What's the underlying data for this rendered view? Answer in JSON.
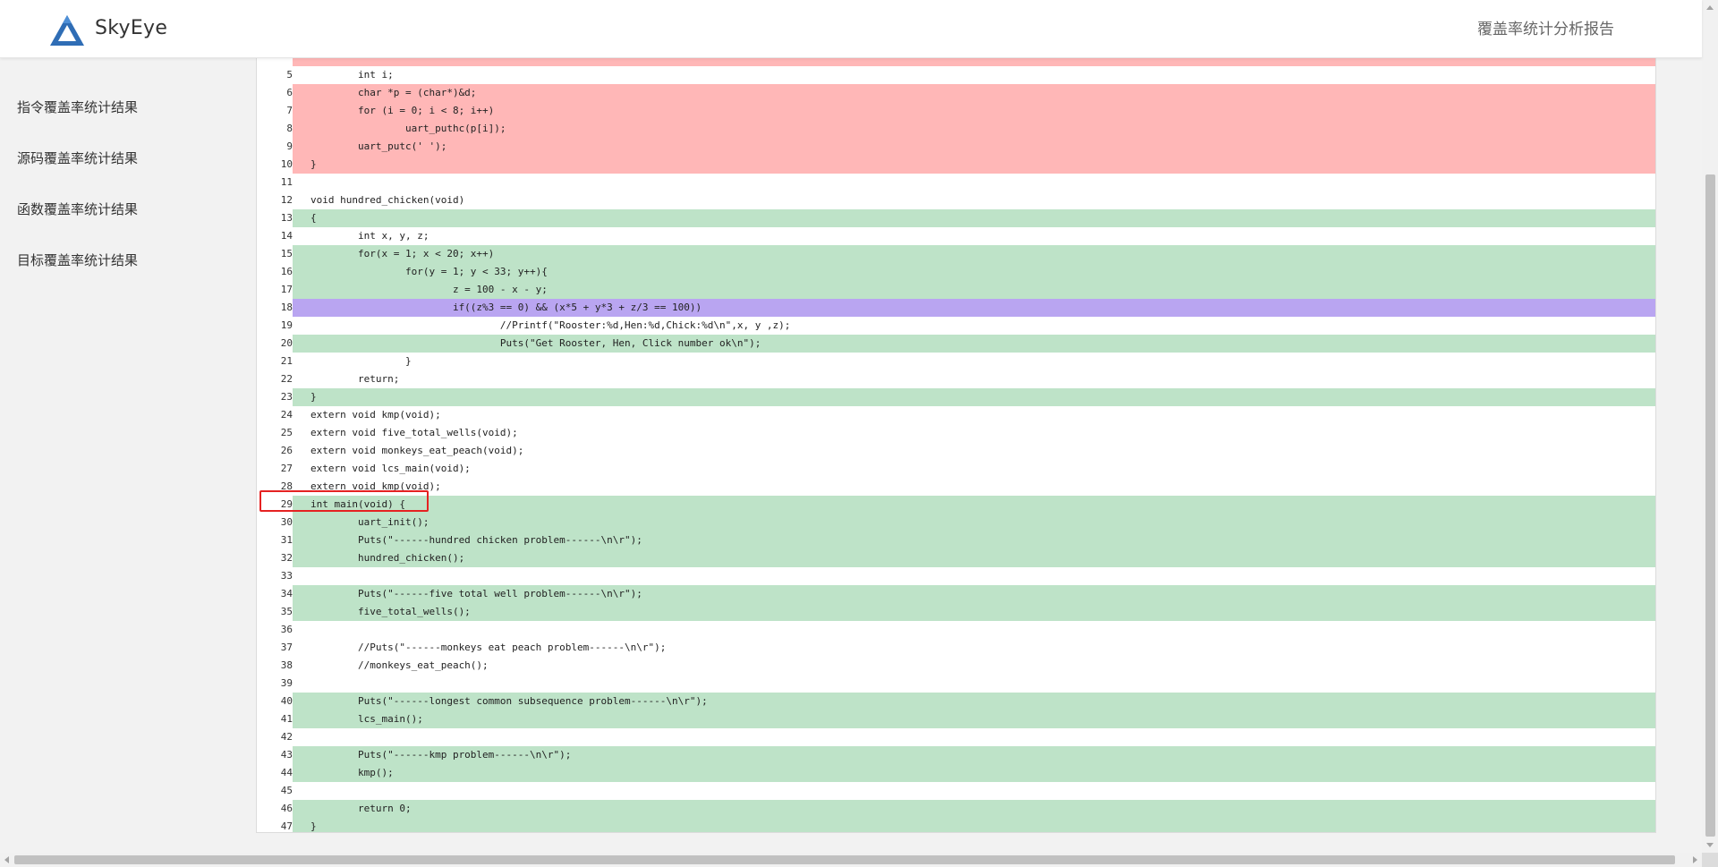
{
  "header": {
    "brand": "SkyEye",
    "report_title": "覆盖率统计分析报告",
    "logo_icon": "skyeye-logo-icon",
    "logo_color": "#2f6db5"
  },
  "sidebar": {
    "items": [
      {
        "label": "指令覆盖率统计结果"
      },
      {
        "label": "源码覆盖率统计结果"
      },
      {
        "label": "函数覆盖率统计结果"
      },
      {
        "label": "目标覆盖率统计结果"
      }
    ]
  },
  "colors": {
    "uncovered": "#ffb7b7",
    "covered": "#bee3c8",
    "partial": "#b9a5f1",
    "highlight_box": "#e52222"
  },
  "code": {
    "highlighted_line": "29",
    "lines": [
      {
        "num": "",
        "text": "    ",
        "cov": "red"
      },
      {
        "num": "5",
        "text": "        int i;",
        "cov": "none"
      },
      {
        "num": "6",
        "text": "        char *p = (char*)&d;",
        "cov": "red"
      },
      {
        "num": "7",
        "text": "        for (i = 0; i < 8; i++)",
        "cov": "red"
      },
      {
        "num": "8",
        "text": "                uart_puthc(p[i]);",
        "cov": "red"
      },
      {
        "num": "9",
        "text": "        uart_putc(' ');",
        "cov": "red"
      },
      {
        "num": "10",
        "text": "}",
        "cov": "red"
      },
      {
        "num": "11",
        "text": "",
        "cov": "none"
      },
      {
        "num": "12",
        "text": "void hundred_chicken(void)",
        "cov": "none"
      },
      {
        "num": "13",
        "text": "{",
        "cov": "green"
      },
      {
        "num": "14",
        "text": "        int x, y, z;",
        "cov": "none"
      },
      {
        "num": "15",
        "text": "        for(x = 1; x < 20; x++)",
        "cov": "green"
      },
      {
        "num": "16",
        "text": "                for(y = 1; y < 33; y++){",
        "cov": "green"
      },
      {
        "num": "17",
        "text": "                        z = 100 - x - y;",
        "cov": "green"
      },
      {
        "num": "18",
        "text": "                        if((z%3 == 0) && (x*5 + y*3 + z/3 == 100))",
        "cov": "purple"
      },
      {
        "num": "19",
        "text": "                                //Printf(\"Rooster:%d,Hen:%d,Chick:%d\\n\",x, y ,z);",
        "cov": "none"
      },
      {
        "num": "20",
        "text": "                                Puts(\"Get Rooster, Hen, Click number ok\\n\");",
        "cov": "green"
      },
      {
        "num": "21",
        "text": "                }",
        "cov": "none"
      },
      {
        "num": "22",
        "text": "        return;",
        "cov": "none"
      },
      {
        "num": "23",
        "text": "}",
        "cov": "green"
      },
      {
        "num": "24",
        "text": "extern void kmp(void);",
        "cov": "none"
      },
      {
        "num": "25",
        "text": "extern void five_total_wells(void);",
        "cov": "none"
      },
      {
        "num": "26",
        "text": "extern void monkeys_eat_peach(void);",
        "cov": "none"
      },
      {
        "num": "27",
        "text": "extern void lcs_main(void);",
        "cov": "none"
      },
      {
        "num": "28",
        "text": "extern void kmp(void);",
        "cov": "none"
      },
      {
        "num": "29",
        "text": "int main(void) {",
        "cov": "green"
      },
      {
        "num": "30",
        "text": "        uart_init();",
        "cov": "green"
      },
      {
        "num": "31",
        "text": "        Puts(\"------hundred chicken problem------\\n\\r\");",
        "cov": "green"
      },
      {
        "num": "32",
        "text": "        hundred_chicken();",
        "cov": "green"
      },
      {
        "num": "33",
        "text": "",
        "cov": "none"
      },
      {
        "num": "34",
        "text": "        Puts(\"------five total well problem------\\n\\r\");",
        "cov": "green"
      },
      {
        "num": "35",
        "text": "        five_total_wells();",
        "cov": "green"
      },
      {
        "num": "36",
        "text": "",
        "cov": "none"
      },
      {
        "num": "37",
        "text": "        //Puts(\"------monkeys eat peach problem------\\n\\r\");",
        "cov": "none"
      },
      {
        "num": "38",
        "text": "        //monkeys_eat_peach();",
        "cov": "none"
      },
      {
        "num": "39",
        "text": "",
        "cov": "none"
      },
      {
        "num": "40",
        "text": "        Puts(\"------longest common subsequence problem------\\n\\r\");",
        "cov": "green"
      },
      {
        "num": "41",
        "text": "        lcs_main();",
        "cov": "green"
      },
      {
        "num": "42",
        "text": "",
        "cov": "none"
      },
      {
        "num": "43",
        "text": "        Puts(\"------kmp problem------\\n\\r\");",
        "cov": "green"
      },
      {
        "num": "44",
        "text": "        kmp();",
        "cov": "green"
      },
      {
        "num": "45",
        "text": "",
        "cov": "none"
      },
      {
        "num": "46",
        "text": "        return 0;",
        "cov": "green"
      },
      {
        "num": "47",
        "text": "}",
        "cov": "green"
      }
    ]
  }
}
